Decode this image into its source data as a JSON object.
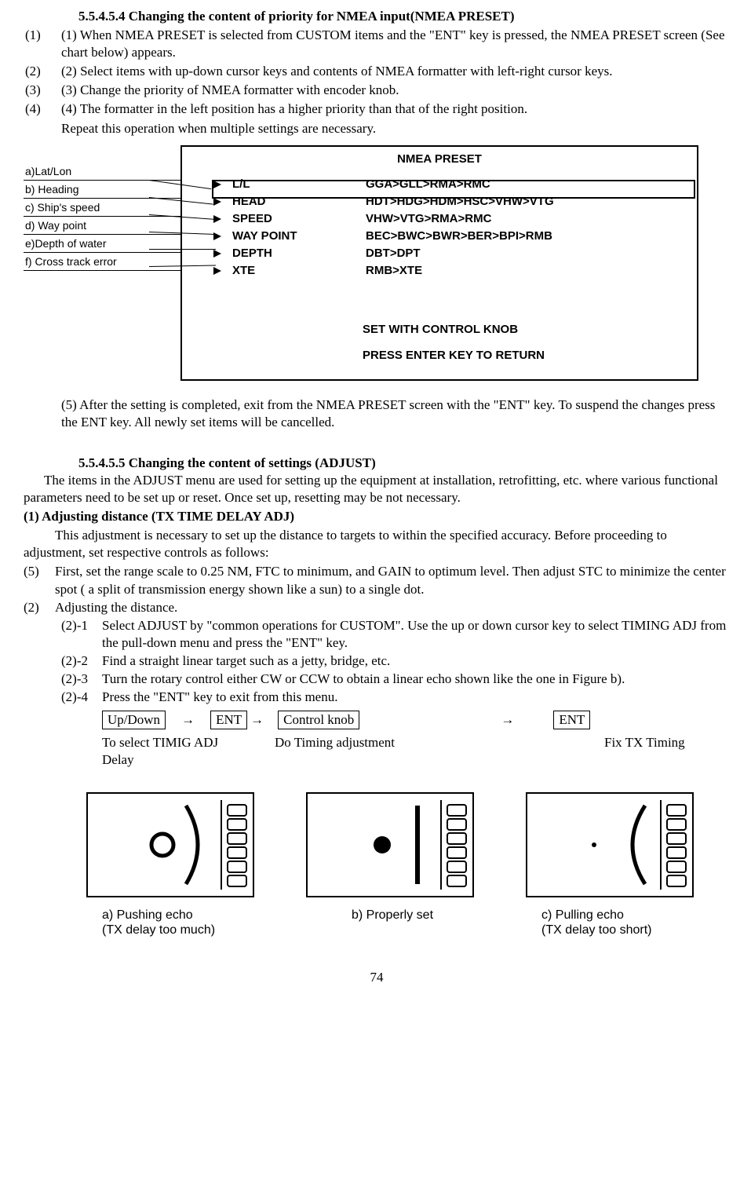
{
  "section1": {
    "heading": "5.5.4.5.4 Changing the content of priority for NMEA input(NMEA PRESET)",
    "items": [
      {
        "outer": "(1)",
        "text": "(1)  When NMEA PRESET is selected from CUSTOM items and the \"ENT\" key is pressed, the NMEA PRESET screen (See chart below) appears."
      },
      {
        "outer": "(2)",
        "text": "(2)  Select items with up-down cursor keys and contents of NMEA formatter with left-right cursor keys."
      },
      {
        "outer": "(3)",
        "text": "(3)  Change the priority of NMEA formatter with encoder knob."
      },
      {
        "outer": "(4)",
        "text": "(4)  The formatter in the left position has a higher priority than that of the right position."
      }
    ],
    "repeat": "Repeat this operation when multiple settings are necessary."
  },
  "preset": {
    "title": "NMEA PRESET",
    "labels": [
      "a)Lat/Lon",
      "b) Heading",
      "c) Ship's speed",
      "d) Way point",
      "e)Depth of water",
      "f) Cross track error"
    ],
    "rows": [
      {
        "c1": "L/L",
        "c2": "GGA>GLL>RMA>RMC"
      },
      {
        "c1": "HEAD",
        "c2": "HDT>HDG>HDM>HSC>VHW>VTG"
      },
      {
        "c1": "SPEED",
        "c2": "VHW>VTG>RMA>RMC"
      },
      {
        "c1": "WAY POINT",
        "c2": "BEC>BWC>BWR>BER>BPI>RMB"
      },
      {
        "c1": "DEPTH",
        "c2": "DBT>DPT"
      },
      {
        "c1": "XTE",
        "c2": "RMB>XTE"
      }
    ],
    "footer1": "SET WITH CONTROL KNOB",
    "footer2": "PRESS ENTER KEY TO RETURN"
  },
  "after_preset": "(5)  After the setting is completed, exit from the NMEA PRESET screen with the \"ENT\" key. To suspend the changes press the ENT key. All newly set items will be cancelled.",
  "section2": {
    "heading": "5.5.4.5.5 Changing the content of settings (ADJUST)",
    "intro": "The items in the ADJUST menu are used for setting up the equipment at installation, retrofitting, etc. where various functional parameters need to be set up or reset. Once set up, resetting may be not necessary.",
    "sub1_heading": "(1) Adjusting distance (TX TIME DELAY ADJ)",
    "sub1_intro": "This adjustment is necessary to set up the distance to targets to within the specified accuracy. Before proceeding to adjustment, set respective controls as follows:",
    "step5": {
      "n": "(5)",
      "t": "First, set the range scale to 0.25 NM, FTC to minimum, and GAIN to optimum level. Then adjust STC to minimize the center spot ( a split of transmission energy shown like a sun) to a single dot."
    },
    "step2": {
      "n": "(2)",
      "t": "Adjusting the distance."
    },
    "subs": [
      {
        "n": "(2)-1",
        "t": "Select ADJUST by \"common operations for CUSTOM\". Use the up or down cursor key to select TIMING ADJ from the pull-down menu and press the \"ENT\" key."
      },
      {
        "n": "(2)-2",
        "t": "Find a straight linear target such as a jetty, bridge, etc."
      },
      {
        "n": "(2)-3",
        "t": "Turn the rotary control either CW or CCW to obtain a linear echo shown like the one in Figure b)."
      },
      {
        "n": "(2)-4",
        "t": "Press the \"ENT\" key to exit from this menu."
      }
    ]
  },
  "keyseq": {
    "k1": "Up/Down",
    "k2": "ENT",
    "k3": "Control knob",
    "k4": "ENT",
    "arrow": "→",
    "c1a": "To select TIMIG ADJ",
    "c1b": "Delay",
    "c2": "Do Timing adjustment",
    "c3": "Fix TX Timing"
  },
  "diagrams": {
    "a1": "a) Pushing echo",
    "a2": "(TX delay too much)",
    "b1": "b) Properly set",
    "c1": "c) Pulling echo",
    "c2": "(TX delay too short)"
  },
  "pagenum": "74"
}
